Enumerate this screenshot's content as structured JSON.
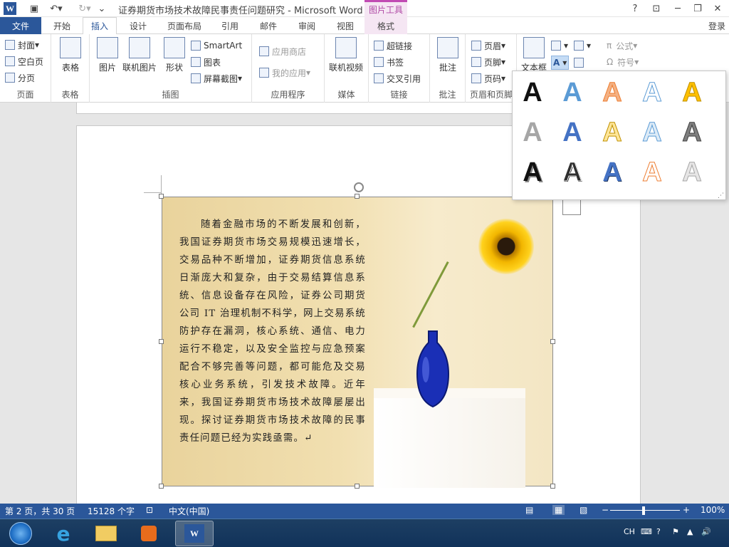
{
  "titlebar": {
    "title": "证券期货市场技术故障民事责任问题研究 - Microsoft Word",
    "context_tab_group": "图片工具",
    "help": "?",
    "login": "登录"
  },
  "tabs": [
    "文件",
    "开始",
    "插入",
    "设计",
    "页面布局",
    "引用",
    "邮件",
    "审阅",
    "视图",
    "格式"
  ],
  "ribbon": {
    "pages": {
      "label": "页面",
      "cover": "封面",
      "blank": "空白页",
      "break": "分页"
    },
    "tables": {
      "label": "表格",
      "table": "表格"
    },
    "illustrations": {
      "label": "插图",
      "picture": "图片",
      "online_picture": "联机图片",
      "shapes": "形状",
      "smartart": "SmartArt",
      "chart": "图表",
      "screenshot": "屏幕截图"
    },
    "apps": {
      "label": "应用程序",
      "store": "应用商店",
      "my_apps": "我的应用"
    },
    "media": {
      "label": "媒体",
      "online_video": "联机视频"
    },
    "links": {
      "label": "链接",
      "hyperlink": "超链接",
      "bookmark": "书签",
      "cross_ref": "交叉引用"
    },
    "comments": {
      "label": "批注",
      "comment": "批注"
    },
    "header_footer": {
      "label": "页眉和页脚",
      "header": "页眉",
      "footer": "页脚",
      "page_number": "页码"
    },
    "text": {
      "textbox": "文本框"
    },
    "symbols": {
      "equation": "公式",
      "symbol": "符号"
    }
  },
  "wordart_gallery": {
    "rows": [
      [
        {
          "glyph": "A",
          "color": "#111111"
        },
        {
          "glyph": "A",
          "color": "#5b9bd5"
        },
        {
          "glyph": "A",
          "color": "#f4b183"
        },
        {
          "glyph": "A",
          "color": "#ffffff"
        },
        {
          "glyph": "A",
          "color": "#ffc000"
        }
      ],
      [
        {
          "glyph": "A",
          "color": "#a6a6a6"
        },
        {
          "glyph": "A",
          "color": "#4472c4"
        },
        {
          "glyph": "A",
          "color": "#ffe699"
        },
        {
          "glyph": "A",
          "color": "#ddebf7"
        },
        {
          "glyph": "A",
          "color": "#7f7f7f"
        }
      ],
      [
        {
          "glyph": "A",
          "color": "#111111"
        },
        {
          "glyph": "A",
          "color": "#2f2f2f"
        },
        {
          "glyph": "A",
          "color": "#4472c4"
        },
        {
          "glyph": "A",
          "color": "#ffffff"
        },
        {
          "glyph": "A",
          "color": "#e7e6e6"
        }
      ]
    ]
  },
  "document": {
    "paragraph": "随着金融市场的不断发展和创新，我国证券期货市场交易规模迅速增长，交易品种不断增加，证券期货信息系统日渐庞大和复杂，由于交易结算信息系统、信息设备存在风险，证券公司期货公司 IT 治理机制不科学，网上交易系统防护存在漏洞，核心系统、通信、电力运行不稳定，以及安全监控与应急预案配合不够完善等问题，都可能危及交易核心业务系统，引发技术故障。近年来，我国证券期货市场技术故障屡屡出现。探讨证券期货市场技术故障的民事责任问题已经为实践亟需。↵"
  },
  "statusbar": {
    "page": "第 2 页，共 30 页",
    "words": "15128 个字",
    "language": "中文(中国)",
    "zoom": "100%"
  },
  "taskbar": {
    "ime": "CH"
  },
  "colors": {
    "accent": "#2b579a",
    "context": "#b04aa6"
  }
}
